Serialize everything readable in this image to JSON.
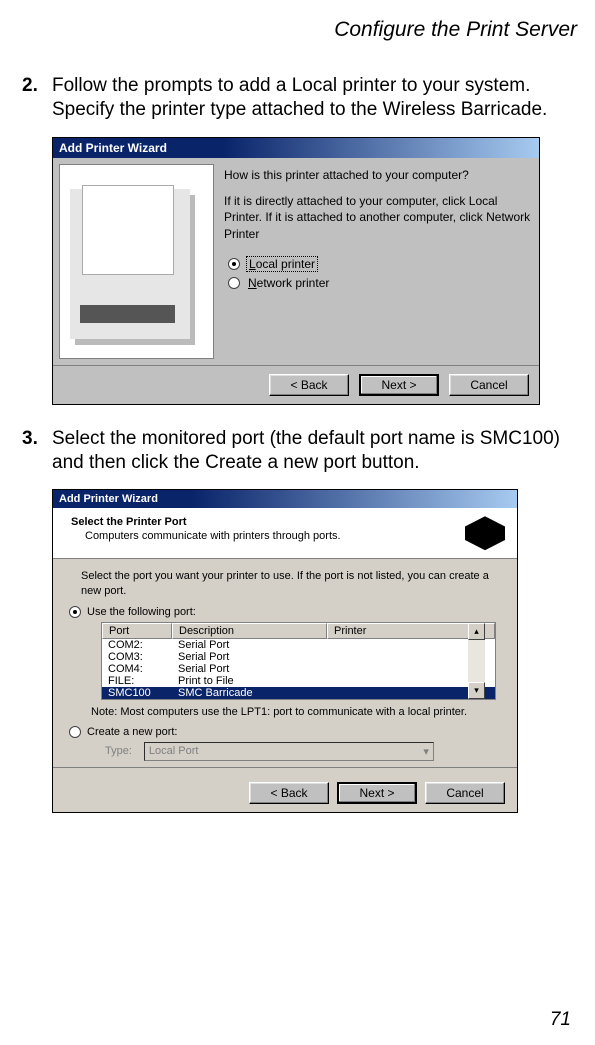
{
  "header": "Configure the Print Server",
  "page_number": "71",
  "step2": {
    "num": "2.",
    "text": "Follow the prompts to add a Local printer to your system. Specify the printer type attached to the Wireless Barricade."
  },
  "step3": {
    "num": "3.",
    "text": "Select the monitored port (the default port name is SMC100) and then click the Create a new port button."
  },
  "wiz1": {
    "title": "Add Printer Wizard",
    "question": "How is this printer attached to your computer?",
    "subtext": "If it is directly attached to your computer, click Local Printer. If it is attached to another computer, click Network Printer",
    "opt_local": "Local printer",
    "opt_network": "Network printer",
    "back": "< Back",
    "next": "Next >",
    "cancel": "Cancel"
  },
  "wiz2": {
    "title": "Add Printer Wizard",
    "head_title": "Select the Printer Port",
    "head_sub": "Computers communicate with printers through ports.",
    "prompt": "Select the port you want your printer to use.  If the port is not listed, you can create a new port.",
    "opt_use": "Use the following port:",
    "col_port": "Port",
    "col_desc": "Description",
    "col_printer": "Printer",
    "rows": [
      {
        "port": "COM2:",
        "desc": "Serial Port",
        "printer": ""
      },
      {
        "port": "COM3:",
        "desc": "Serial Port",
        "printer": ""
      },
      {
        "port": "COM4:",
        "desc": "Serial Port",
        "printer": ""
      },
      {
        "port": "FILE:",
        "desc": "Print to File",
        "printer": ""
      },
      {
        "port": "SMC100",
        "desc": "SMC Barricade",
        "printer": ""
      }
    ],
    "note": "Note: Most computers use the LPT1: port to communicate with a local printer.",
    "opt_create": "Create a new port:",
    "type_label": "Type:",
    "type_value": "Local Port",
    "back": "< Back",
    "next": "Next >",
    "cancel": "Cancel"
  }
}
